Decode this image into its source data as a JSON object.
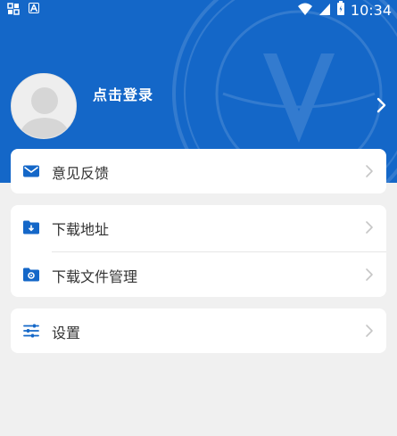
{
  "status_bar": {
    "left_icons": [
      "gallery-icon",
      "text-a-icon"
    ],
    "right_icons": [
      "wifi-icon",
      "signal-icon",
      "battery-icon"
    ],
    "time": "10:34"
  },
  "profile": {
    "login_label": "点击登录"
  },
  "menu": {
    "feedback": "意见反馈",
    "download_address": "下载地址",
    "download_files": "下载文件管理",
    "settings": "设置"
  },
  "colors": {
    "header_bg": "#1467c8",
    "icon_blue": "#1467c8",
    "page_bg": "#f0f0f0"
  }
}
